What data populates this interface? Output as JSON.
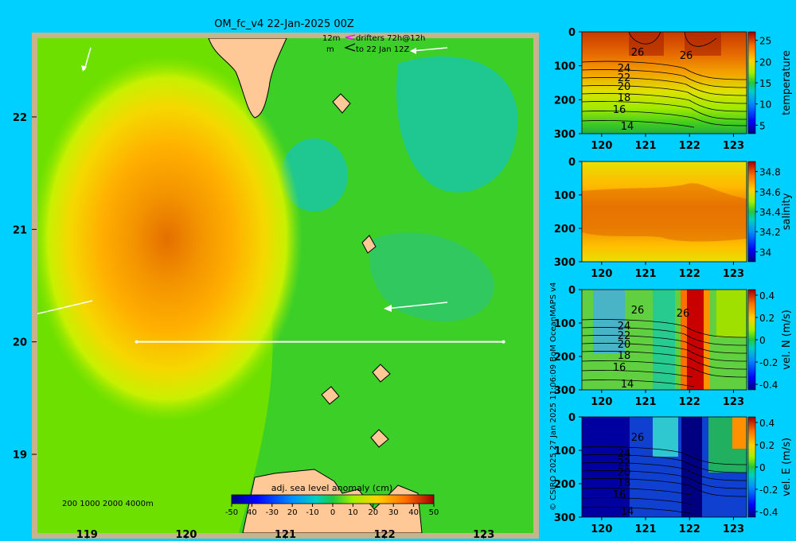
{
  "title": "OM_fc_v4  22-Jan-2025 00Z",
  "legend": {
    "line1a": "12m",
    "line1b": "drifters 72h@12h",
    "line2a": "m",
    "line2b": "to 22 Jan 12Z"
  },
  "depth_legend": "200  1000  2000  4000m",
  "credit": "© CSIRO 2025   27 Jan 2025 11:06:09 BoM OceanMAPS v4",
  "colors": {
    "background": "#00d0ff",
    "land": "#ffc896",
    "coast_band": "#c8b48c",
    "transect": "#ffffff"
  },
  "chart_data": [
    {
      "type": "heatmap",
      "name": "map",
      "title": "OM_fc_v4  22-Jan-2025 00Z",
      "xlim": [
        118.5,
        123.5
      ],
      "ylim": [
        18.3,
        22.7
      ],
      "xticks": [
        119,
        120,
        121,
        122,
        123
      ],
      "yticks": [
        19,
        20,
        21,
        22
      ],
      "colorbar": {
        "label": "adj. sea level anomaly (cm)",
        "range": [
          -50,
          50
        ],
        "ticks": [
          -50,
          -40,
          -30,
          -20,
          -10,
          0,
          10,
          20,
          30,
          40,
          50
        ],
        "tick_labels": [
          "-50",
          "40",
          "-30",
          "20",
          "-10",
          "0",
          "10",
          "20",
          "30",
          "40",
          "50"
        ]
      },
      "features": {
        "eddy_center": {
          "lon": 119.85,
          "lat": 20.85,
          "value": 42
        },
        "transect": {
          "lat": 20.0,
          "lon_start": 119.5,
          "lon_end": 123.2
        }
      }
    },
    {
      "type": "heatmap",
      "name": "temperature",
      "clabel": "temperature",
      "xticks": [
        120,
        121,
        122,
        123
      ],
      "yticks": [
        0,
        100,
        200,
        300
      ],
      "colorbar_ticks": [
        5,
        10,
        15,
        20,
        25
      ],
      "colorbar_range": [
        3,
        27
      ],
      "contour_labels": [
        "26",
        "26",
        "24",
        "22",
        "20",
        "18",
        "16",
        "14"
      ]
    },
    {
      "type": "heatmap",
      "name": "salinity",
      "clabel": "salinity",
      "xticks": [
        120,
        121,
        122,
        123
      ],
      "yticks": [
        0,
        100,
        200,
        300
      ],
      "colorbar_ticks": [
        34,
        34.2,
        34.4,
        34.6,
        34.8
      ],
      "colorbar_tick_labels": [
        "34",
        "34.2",
        "34.4",
        "34.6",
        "34.8"
      ],
      "colorbar_range": [
        33.9,
        34.9
      ]
    },
    {
      "type": "heatmap",
      "name": "vel_n",
      "clabel": "vel. N (m/s)",
      "xticks": [
        120,
        121,
        122,
        123
      ],
      "yticks": [
        0,
        100,
        200,
        300
      ],
      "colorbar_ticks": [
        -0.4,
        -0.2,
        0,
        0.2,
        0.4
      ],
      "colorbar_tick_labels": [
        "-0.4",
        "-0.2",
        "0",
        "0.2",
        "0.4"
      ],
      "colorbar_range": [
        -0.45,
        0.45
      ],
      "contour_labels": [
        "26",
        "26",
        "24",
        "22",
        "20",
        "18",
        "16",
        "14"
      ]
    },
    {
      "type": "heatmap",
      "name": "vel_e",
      "clabel": "vel. E (m/s)",
      "xticks": [
        120,
        121,
        122,
        123
      ],
      "yticks": [
        0,
        100,
        200,
        300
      ],
      "colorbar_ticks": [
        -0.4,
        -0.2,
        0,
        0.2,
        0.4
      ],
      "colorbar_tick_labels": [
        "-0.4",
        "-0.2",
        "0",
        "0.2",
        "0.4"
      ],
      "colorbar_range": [
        -0.45,
        0.45
      ],
      "contour_labels": [
        "26",
        "24",
        "22",
        "20",
        "18",
        "16",
        "14"
      ]
    }
  ]
}
